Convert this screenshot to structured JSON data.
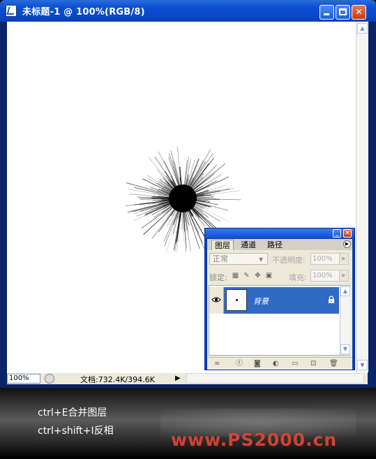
{
  "window": {
    "title": "未标题-1 @ 100%(RGB/8)"
  },
  "status_bar": {
    "zoom": "100%",
    "doc_info": "文档:732.4K/394.6K"
  },
  "layers_panel": {
    "tabs": [
      "图层",
      "通道",
      "路径"
    ],
    "blend_mode": "正常",
    "opacity_label": "不透明度:",
    "opacity_value": "100%",
    "lock_label": "锁定:",
    "fill_label": "填充:",
    "fill_value": "100%",
    "layers": [
      {
        "name": "背景",
        "visible": true,
        "locked": true,
        "selected": true
      }
    ]
  },
  "caption": {
    "lines": [
      "ctrl+E合并图层",
      "ctrl+shift+I反相"
    ],
    "watermark": "www.PS2000.cn"
  },
  "colors": {
    "titlebar": "#0b4fd4",
    "layer_selected": "#316ac5",
    "watermark": "#d8483a"
  }
}
